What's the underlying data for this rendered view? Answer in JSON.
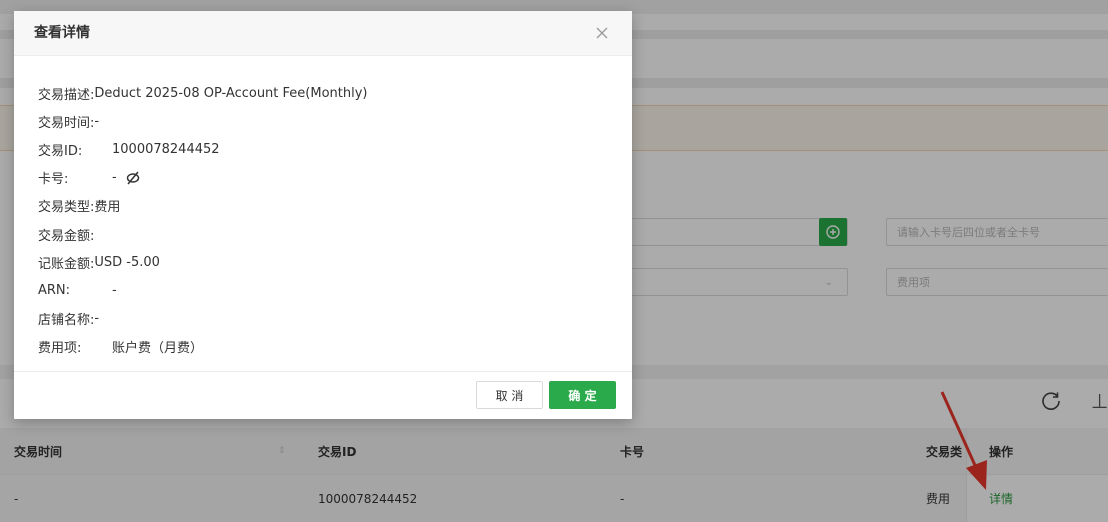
{
  "modal": {
    "title": "查看详情",
    "fields": [
      {
        "label": "交易描述:",
        "value": "Deduct 2025-08 OP-Account Fee(Monthly)"
      },
      {
        "label": "交易时间:",
        "value": "-"
      },
      {
        "label": "交易ID:",
        "value": "1000078244452"
      },
      {
        "label": "卡号:",
        "value": "-"
      },
      {
        "label": "交易类型:",
        "value": "费用"
      },
      {
        "label": "交易金额:",
        "value": ""
      },
      {
        "label": "记账金额:",
        "value": "USD -5.00"
      },
      {
        "label": "ARN:",
        "value": "-"
      },
      {
        "label": "店铺名称:",
        "value": "-"
      },
      {
        "label": "费用项:",
        "value": "账户费（月费）"
      }
    ],
    "cancel_label": "取 消",
    "ok_label": "确 定"
  },
  "filters": {
    "card_placeholder": "请输入卡号后四位或者全卡号",
    "fee_item_placeholder": "费用项"
  },
  "table": {
    "headers": {
      "time": "交易时间",
      "id": "交易ID",
      "card": "卡号",
      "type": "交易类",
      "ops": "操作"
    },
    "rows": [
      {
        "time": "-",
        "id": "1000078244452",
        "card": "-",
        "type": "费用",
        "action": "详情"
      }
    ]
  },
  "colors": {
    "primary": "#2aaa4a",
    "link": "#2b9a3e",
    "annotation_arrow": "#e8382c"
  }
}
